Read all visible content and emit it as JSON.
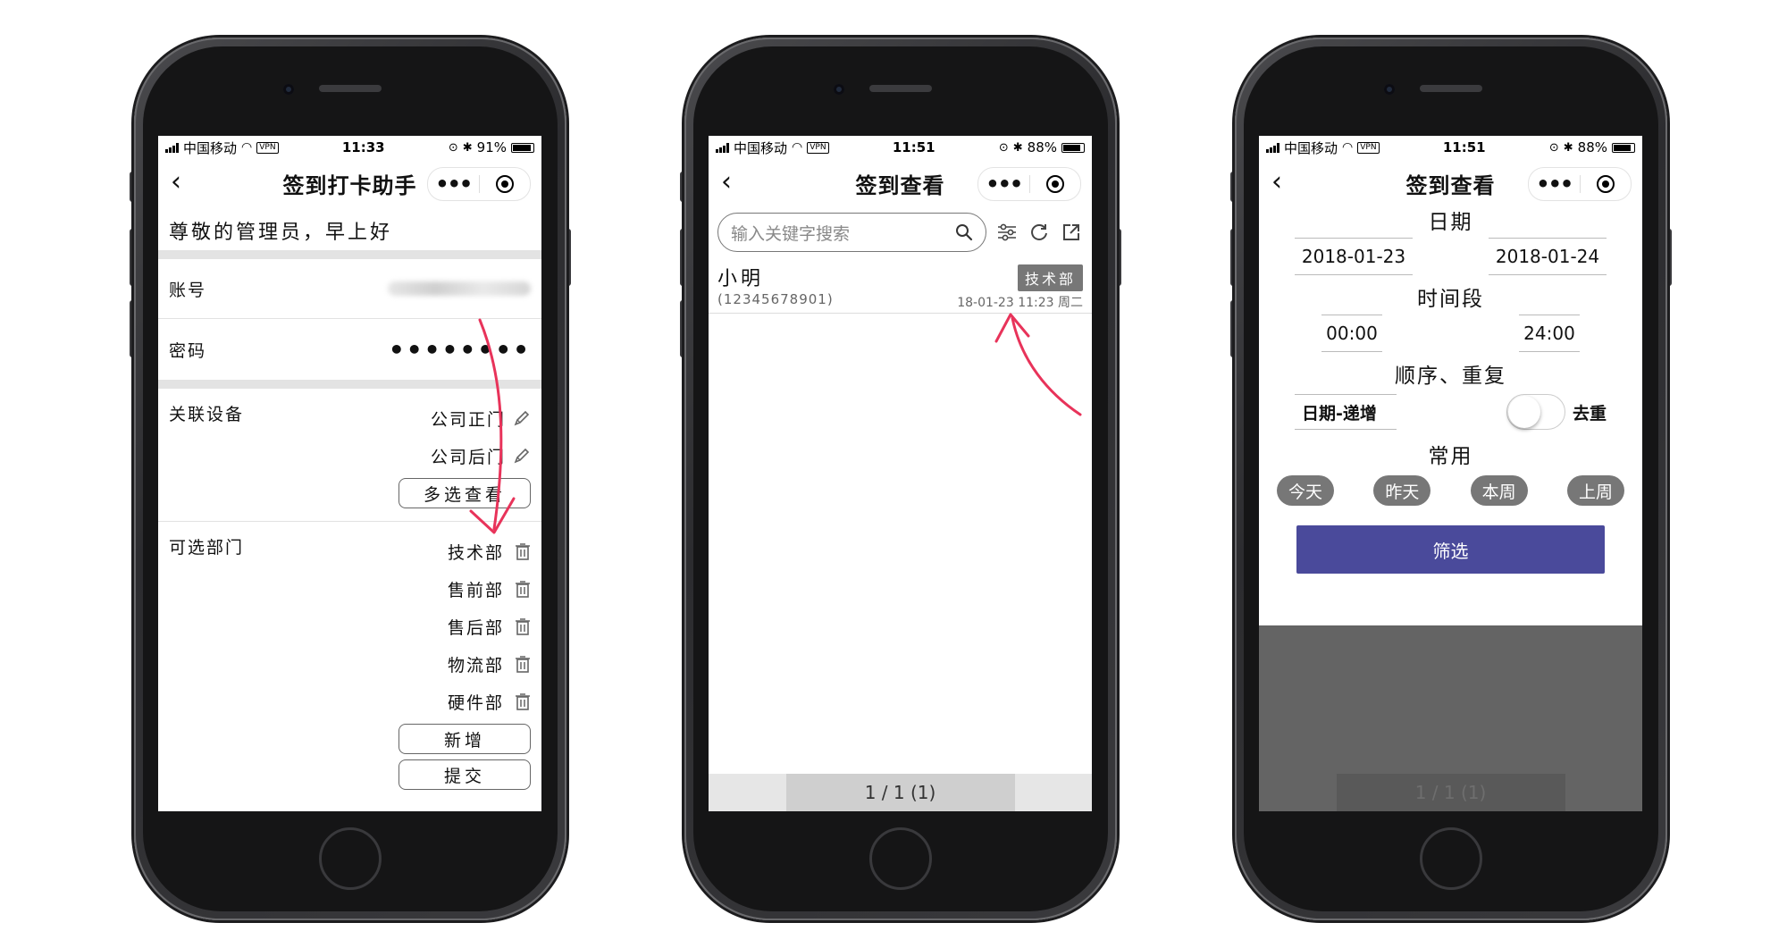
{
  "status_bars": [
    {
      "carrier": "中国移动",
      "vpn": "VPN",
      "time": "11:33",
      "battery": "91%",
      "battery_level": 0.91
    },
    {
      "carrier": "中国移动",
      "vpn": "VPN",
      "time": "11:51",
      "battery": "88%",
      "battery_level": 0.88
    },
    {
      "carrier": "中国移动",
      "vpn": "VPN",
      "time": "11:51",
      "battery": "88%",
      "battery_level": 0.88
    }
  ],
  "capsule": {
    "more_icon": "more-dots-icon",
    "close_icon": "target-icon"
  },
  "screen1": {
    "title": "签到打卡助手",
    "greeting": "尊敬的管理员，早上好",
    "account_label": "账号",
    "password_label": "密码",
    "password_mask": "••••••••",
    "devices_label": "关联设备",
    "devices": [
      "公司正门",
      "公司后门"
    ],
    "multi_view_button": "多选查看",
    "departments_label": "可选部门",
    "departments": [
      "技术部",
      "售前部",
      "售后部",
      "物流部",
      "硬件部"
    ],
    "add_button": "新增",
    "submit_button": "提交"
  },
  "screen2": {
    "title": "签到查看",
    "search_placeholder": "输入关键字搜索",
    "record": {
      "name": "小明",
      "phone": "(12345678901)",
      "department": "技术部",
      "time": "18-01-23 11:23 周二"
    },
    "pager": "1 / 1 (1)"
  },
  "screen3": {
    "title": "签到查看",
    "date_label": "日期",
    "date_start": "2018-01-23",
    "date_end": "2018-01-24",
    "time_label": "时间段",
    "time_start": "00:00",
    "time_end": "24:00",
    "order_label": "顺序、重复",
    "order_value": "日期-递增",
    "dedupe_label": "去重",
    "dedupe_on": false,
    "common_label": "常用",
    "quick_ranges": [
      "今天",
      "昨天",
      "本周",
      "上周"
    ],
    "filter_button": "筛选",
    "pager": "1 / 1 (1)"
  },
  "colors": {
    "accent_button": "#4a4a9b",
    "chip_gray": "#777777",
    "annotation_arrow": "#e8335a"
  }
}
